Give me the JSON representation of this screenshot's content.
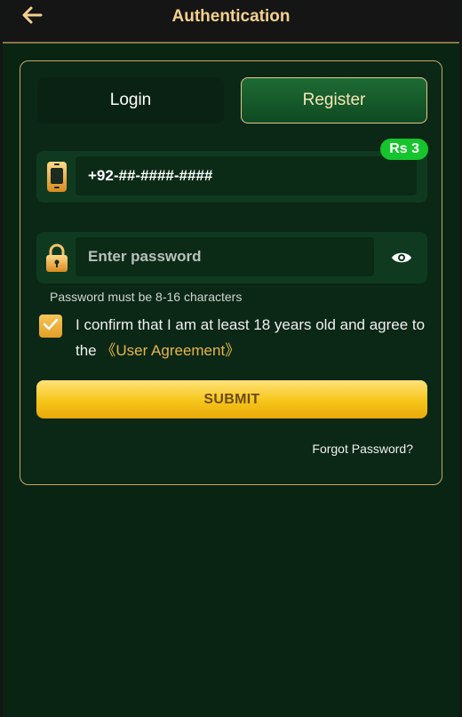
{
  "header": {
    "title": "Authentication",
    "back_icon": "arrow-left-icon"
  },
  "tabs": [
    {
      "label": "Login",
      "active": false
    },
    {
      "label": "Register",
      "active": true
    }
  ],
  "phone": {
    "icon": "phone-icon",
    "value": "+92-##-####-####",
    "badge": "Rs 3"
  },
  "password": {
    "icon": "lock-icon",
    "placeholder": "Enter password",
    "toggle_icon": "eye-icon",
    "hint": "Password must be 8-16 characters"
  },
  "agreement": {
    "checked": true,
    "text": "I confirm that I am at least 18 years old and agree to the ",
    "link": "《User Agreement》"
  },
  "submit_label": "SUBMIT",
  "forgot_label": "Forgot Password?",
  "colors": {
    "accent_gold": "#e7b54a",
    "badge_green": "#16c42d",
    "background": "#0a2414"
  }
}
